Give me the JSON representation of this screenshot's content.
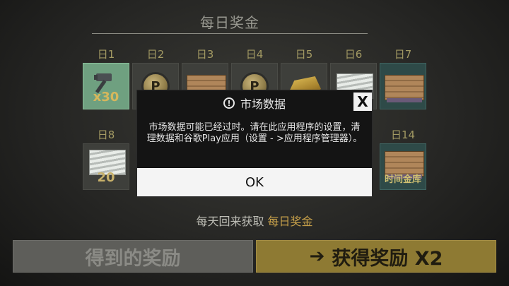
{
  "header": {
    "title": "每日奖金"
  },
  "days": [
    {
      "label": "日1",
      "reward": "hammer",
      "count": "x30",
      "claimed": true
    },
    {
      "label": "日2",
      "reward": "coin"
    },
    {
      "label": "日3",
      "reward": "crate"
    },
    {
      "label": "日4",
      "reward": "coin"
    },
    {
      "label": "日5",
      "reward": "gold"
    },
    {
      "label": "日6",
      "reward": "cash"
    },
    {
      "label": "日7",
      "reward": "crate"
    },
    {
      "label": "日8",
      "reward": "cash",
      "count": "20"
    },
    {
      "label": "日14",
      "reward": "crate",
      "count": "时间金库"
    }
  ],
  "icons": {
    "coin_letter": "P",
    "close_glyph": "X",
    "warning_glyph": "!",
    "arrow_glyph": "➔"
  },
  "footer": {
    "prefix": "每天回来获取",
    "highlight": "每日奖金"
  },
  "buttons": {
    "get_reward": "得到的奖励",
    "get_reward_x2": "获得奖励 X2"
  },
  "modal": {
    "title": "市场数据",
    "message": "市场数据可能已经过时。请在此应用程序的设置，清理数据和谷歌Play应用（设置 - >应用程序管理器）。",
    "ok_label": "OK"
  },
  "colors": {
    "accent_gold": "#c8a14a",
    "claimed_green": "#6fa080",
    "modal_bg": "#141414"
  }
}
